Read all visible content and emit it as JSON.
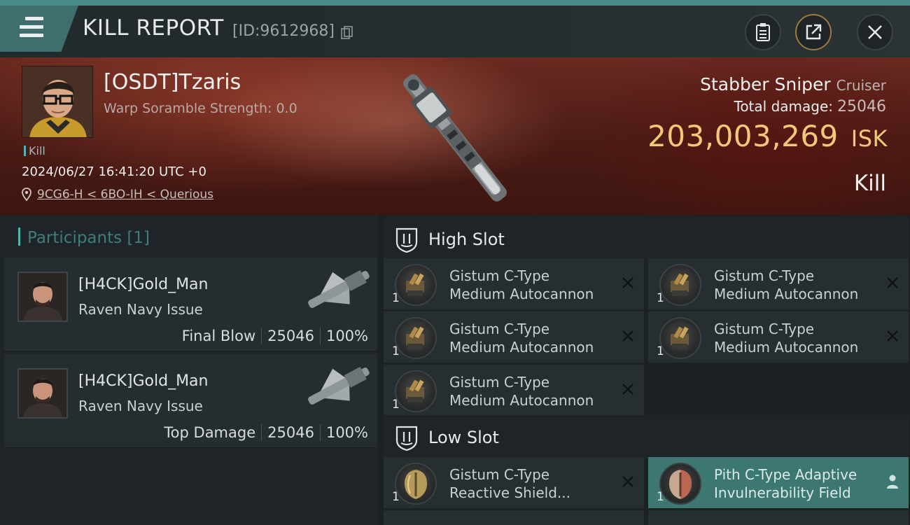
{
  "header": {
    "title": "KILL REPORT",
    "report_id": "[ID:9612968]"
  },
  "victim": {
    "name": "[OSDT]Tzaris",
    "warp_scramble": "Warp Soramble Strength: 0.0",
    "tag": "Kill",
    "datetime": "2024/06/27 16:41:20 UTC +0",
    "location": "9CG6-H < 6BO-IH < Querious",
    "ship_name": "Stabber Sniper",
    "ship_class": "Cruiser",
    "total_damage_label": "Total damage:",
    "total_damage": "25046",
    "isk_value": "203,003,269",
    "isk_unit": "ISK",
    "result": "Kill"
  },
  "participants": {
    "label": "Participants",
    "count": "[1]",
    "items": [
      {
        "name": "[H4CK]Gold_Man",
        "ship": "Raven Navy Issue",
        "role": "Final Blow",
        "damage": "25046",
        "percent": "100%"
      },
      {
        "name": "[H4CK]Gold_Man",
        "ship": "Raven Navy Issue",
        "role": "Top Damage",
        "damage": "25046",
        "percent": "100%"
      }
    ]
  },
  "slots": {
    "high": {
      "title": "High Slot",
      "modules": [
        {
          "qty": "1",
          "line1": "Gistum C-Type",
          "line2": "Medium Autocannon"
        },
        {
          "qty": "1",
          "line1": "Gistum C-Type",
          "line2": "Medium Autocannon"
        },
        {
          "qty": "1",
          "line1": "Gistum C-Type",
          "line2": "Medium Autocannon"
        },
        {
          "qty": "1",
          "line1": "Gistum C-Type",
          "line2": "Medium Autocannon"
        },
        {
          "qty": "1",
          "line1": "Gistum C-Type",
          "line2": "Medium Autocannon"
        }
      ]
    },
    "low": {
      "title": "Low Slot",
      "modules": [
        {
          "qty": "1",
          "line1": "Gistum C-Type",
          "line2": "Reactive Shield..."
        },
        {
          "qty": "1",
          "line1": "Pith C-Type Adaptive",
          "line2": "Invulnerability Field"
        }
      ]
    }
  },
  "colors": {
    "accent_teal": "#4fb5ae",
    "isk_gold": "#f2c879",
    "highlight_row": "#3c7772"
  }
}
